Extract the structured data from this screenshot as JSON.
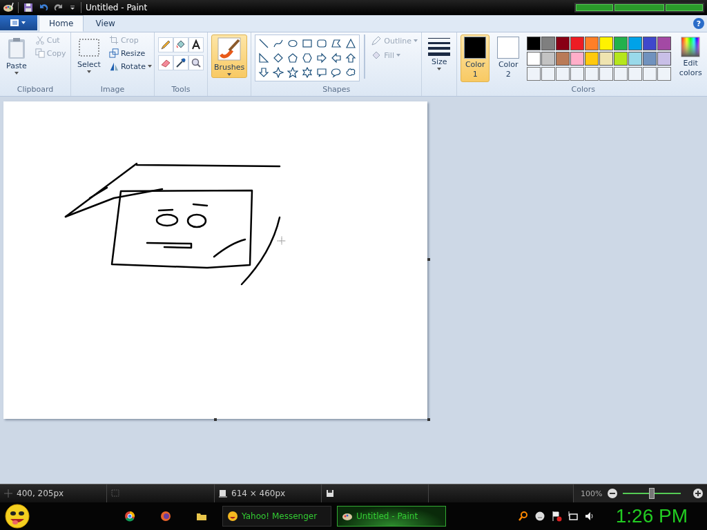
{
  "window": {
    "title": "Untitled - Paint"
  },
  "ribbon_tabs": [
    {
      "label": "Home",
      "selected": true
    },
    {
      "label": "View",
      "selected": false
    }
  ],
  "help": "?",
  "clipboard": {
    "label": "Clipboard",
    "paste": "Paste",
    "cut": {
      "label": "Cut",
      "disabled": true
    },
    "copy": {
      "label": "Copy",
      "disabled": true
    }
  },
  "image": {
    "label": "Image",
    "select": "Select",
    "crop": {
      "label": "Crop",
      "disabled": true
    },
    "resize": "Resize",
    "rotate": "Rotate"
  },
  "tools": {
    "label": "Tools"
  },
  "brushes": {
    "label": "Brushes",
    "selected": true
  },
  "shapes": {
    "label": "Shapes",
    "outline": {
      "label": "Outline",
      "disabled": true
    },
    "fill": {
      "label": "Fill",
      "disabled": true
    }
  },
  "size": {
    "label": "Size"
  },
  "colors": {
    "label": "Colors",
    "color1": {
      "label": "Color 1",
      "color": "#000000",
      "selected": true
    },
    "color2": {
      "label": "Color 2",
      "color": "#ffffff",
      "selected": false
    },
    "palette": [
      {
        "color": "#000000"
      },
      {
        "color": "#7f7f7f"
      },
      {
        "color": "#880015"
      },
      {
        "color": "#ed1c24"
      },
      {
        "color": "#ff7f27"
      },
      {
        "color": "#fff200"
      },
      {
        "color": "#22b14c"
      },
      {
        "color": "#00a2e8"
      },
      {
        "color": "#3f48cc"
      },
      {
        "color": "#a349a4"
      },
      {
        "color": "#ffffff"
      },
      {
        "color": "#c3c3c3"
      },
      {
        "color": "#b97a57"
      },
      {
        "color": "#ffaec9"
      },
      {
        "color": "#ffc90e"
      },
      {
        "color": "#efe4b0"
      },
      {
        "color": "#b5e61d"
      },
      {
        "color": "#99d9ea"
      },
      {
        "color": "#7092be"
      },
      {
        "color": "#c8bfe7"
      }
    ],
    "edit_colors": "Edit colors"
  },
  "status_bar": {
    "cursor_position": "400, 205px",
    "canvas_size": "614 × 460px",
    "zoom": "100%",
    "zoom_slider": {
      "level": 0.5
    }
  },
  "taskbar": {
    "items": [
      {
        "label": "Yahoo! Messenger",
        "selected": false
      },
      {
        "label": "Untitled - Paint",
        "selected": true
      }
    ],
    "clock": "1:26 PM"
  }
}
